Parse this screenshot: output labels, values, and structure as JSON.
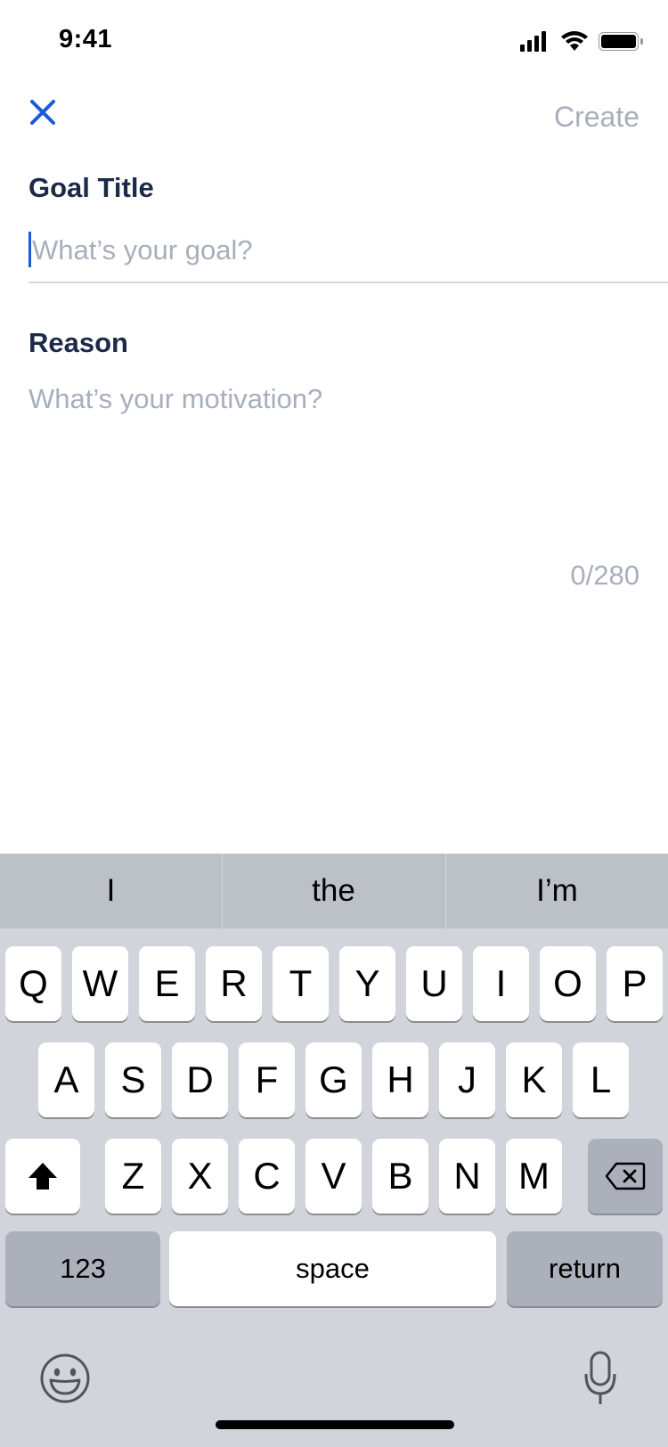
{
  "status_bar": {
    "time": "9:41"
  },
  "header": {
    "create_label": "Create"
  },
  "form": {
    "goal_title_label": "Goal Title",
    "goal_placeholder": "What’s your goal?",
    "reason_label": "Reason",
    "reason_placeholder": "What’s your motivation?",
    "char_count": "0/280"
  },
  "keyboard": {
    "suggestions": [
      "I",
      "the",
      "I’m"
    ],
    "row1": [
      "Q",
      "W",
      "E",
      "R",
      "T",
      "Y",
      "U",
      "I",
      "O",
      "P"
    ],
    "row2": [
      "A",
      "S",
      "D",
      "F",
      "G",
      "H",
      "J",
      "K",
      "L"
    ],
    "row3": [
      "Z",
      "X",
      "C",
      "V",
      "B",
      "N",
      "M"
    ],
    "numbers_label": "123",
    "space_label": "space",
    "return_label": "return"
  },
  "colors": {
    "accent": "#1a5bd6",
    "label_text": "#1c2a48",
    "placeholder": "#a7afbb",
    "keyboard_bg": "#d1d4da"
  }
}
